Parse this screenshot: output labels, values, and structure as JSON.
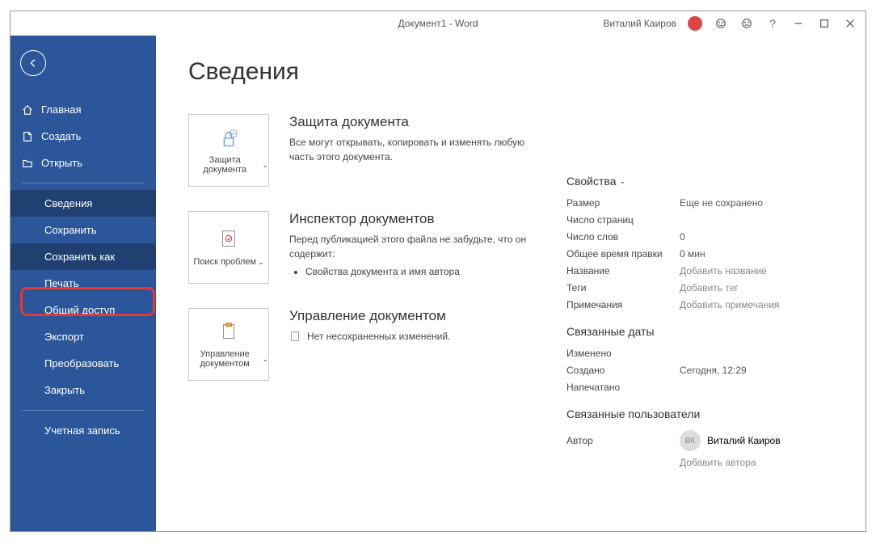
{
  "titlebar": {
    "doc_title": "Документ1 - Word",
    "user_name": "Виталий Каиров"
  },
  "sidebar": {
    "home": "Главная",
    "new": "Создать",
    "open": "Открыть",
    "info": "Сведения",
    "save": "Сохранить",
    "save_as": "Сохранить как",
    "print": "Печать",
    "share": "Общий доступ",
    "export": "Экспорт",
    "transform": "Преобразовать",
    "close": "Закрыть",
    "account": "Учетная запись"
  },
  "page": {
    "title": "Сведения",
    "protect": {
      "button": "Защита документа",
      "heading": "Защита документа",
      "desc": "Все могут открывать, копировать и изменять любую часть этого документа."
    },
    "inspect": {
      "button": "Поиск проблем",
      "heading": "Инспектор документов",
      "desc": "Перед публикацией этого файла не забудьте, что он содержит:",
      "item1": "Свойства документа и имя автора"
    },
    "manage": {
      "button": "Управление документом",
      "heading": "Управление документом",
      "item": "Нет несохраненных изменений."
    }
  },
  "props": {
    "heading": "Свойства",
    "size_label": "Размер",
    "size_value": "Еще не сохранено",
    "pages_label": "Число страниц",
    "words_label": "Число слов",
    "words_value": "0",
    "edit_time_label": "Общее время правки",
    "edit_time_value": "0 мин",
    "title_label": "Название",
    "title_value": "Добавить название",
    "tags_label": "Теги",
    "tags_value": "Добавить тег",
    "comments_label": "Примечания",
    "comments_value": "Добавить примечания",
    "dates_heading": "Связанные даты",
    "modified_label": "Изменено",
    "created_label": "Создано",
    "created_value": "Сегодня, 12:29",
    "printed_label": "Напечатано",
    "people_heading": "Связанные пользователи",
    "author_label": "Автор",
    "author_initials": "ВК",
    "author_name": "Виталий Каиров",
    "add_author": "Добавить автора"
  }
}
